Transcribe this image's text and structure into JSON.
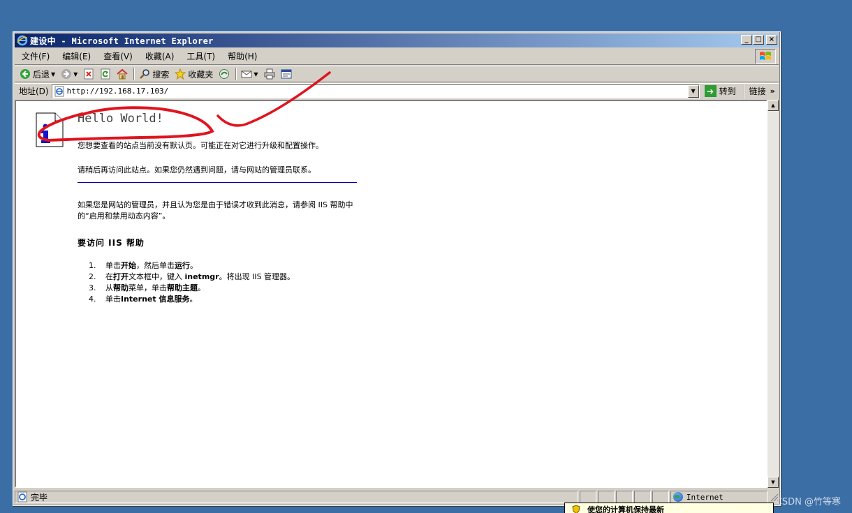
{
  "window": {
    "title": "建设中 - Microsoft Internet Explorer",
    "buttons": {
      "minimize": "_",
      "maximize": "□",
      "close": "×"
    }
  },
  "menu": {
    "items": [
      "文件(F)",
      "编辑(E)",
      "查看(V)",
      "收藏(A)",
      "工具(T)",
      "帮助(H)"
    ]
  },
  "toolbar": {
    "back_label": "后退",
    "search_label": "搜索",
    "favorites_label": "收藏夹"
  },
  "address": {
    "label": "地址(D)",
    "url": "http://192.168.17.103/",
    "go_label": "转到",
    "links_label": "链接",
    "links_chevron": "»"
  },
  "page": {
    "heading": "Hello World!",
    "para1": "您想要查看的站点当前没有默认页。可能正在对它进行升级和配置操作。",
    "para2": "请稍后再访问此站点。如果您仍然遇到问题，请与网站的管理员联系。",
    "para3": "如果您是网站的管理员，并且认为您是由于错误才收到此消息，请参阅 IIS 帮助中的“启用和禁用动态内容”。",
    "help_title": "要访问 IIS 帮助",
    "steps": [
      {
        "num": "1.",
        "parts": [
          {
            "t": "单击",
            "b": false
          },
          {
            "t": "开始",
            "b": true
          },
          {
            "t": "，然后单击",
            "b": false
          },
          {
            "t": "运行",
            "b": true
          },
          {
            "t": "。",
            "b": false
          }
        ]
      },
      {
        "num": "2.",
        "parts": [
          {
            "t": "在",
            "b": false
          },
          {
            "t": "打开",
            "b": true
          },
          {
            "t": "文本框中，键入 ",
            "b": false
          },
          {
            "t": "inetmgr",
            "b": true
          },
          {
            "t": "。将出现 IIS 管理器。",
            "b": false
          }
        ]
      },
      {
        "num": "3.",
        "parts": [
          {
            "t": "从",
            "b": false
          },
          {
            "t": "帮助",
            "b": true
          },
          {
            "t": "菜单，单击",
            "b": false
          },
          {
            "t": "帮助主题",
            "b": true
          },
          {
            "t": "。",
            "b": false
          }
        ]
      },
      {
        "num": "4.",
        "parts": [
          {
            "t": "单击",
            "b": false
          },
          {
            "t": "Internet 信息服务",
            "b": true
          },
          {
            "t": "。",
            "b": false
          }
        ]
      }
    ]
  },
  "status": {
    "text": "完毕",
    "zone": "Internet"
  },
  "balloon": {
    "text": "使您的计算机保持最新"
  },
  "watermark": "CSDN @竹等寒",
  "colors": {
    "desktop": "#3a6ea5",
    "titlebar_start": "#0a246a",
    "titlebar_end": "#a6caf0",
    "annotation_red": "#e0141e",
    "divider_blue": "#0000b0"
  },
  "icons": [
    "ie-icon",
    "windows-logo-icon",
    "back-icon",
    "forward-icon",
    "stop-icon",
    "refresh-icon",
    "home-icon",
    "search-icon",
    "favorites-icon",
    "media-icon",
    "mail-icon",
    "print-icon",
    "edit-icon",
    "page-icon",
    "go-icon",
    "info-icon",
    "globe-icon",
    "shield-icon"
  ]
}
